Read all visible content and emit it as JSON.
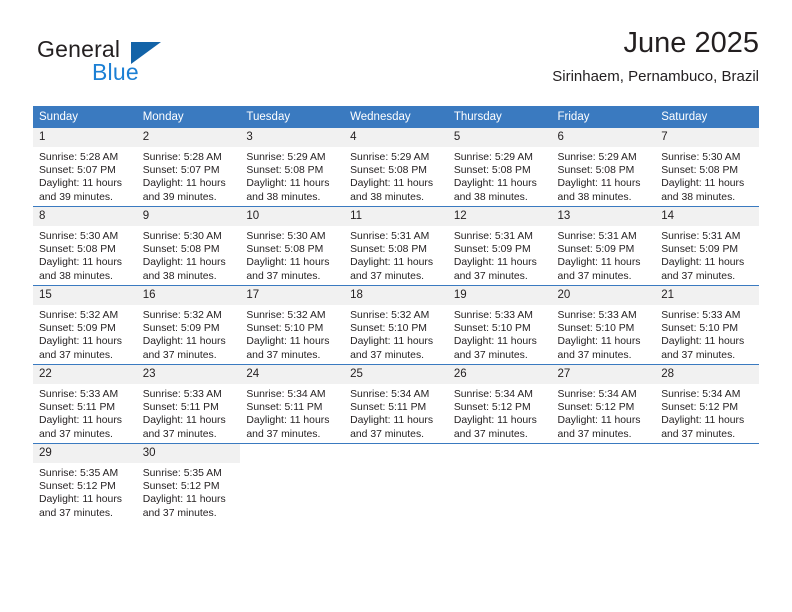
{
  "brand": {
    "name_top": "General",
    "name_bottom": "Blue",
    "color_dark": "#231f20",
    "color_blue": "#1b7fd4",
    "triangle_color": "#1263a8"
  },
  "header": {
    "title": "June 2025",
    "subtitle": "Sirinhaem, Pernambuco, Brazil"
  },
  "theme": {
    "header_bg": "#3a7ac0",
    "header_text": "#ffffff",
    "daynum_bg": "#f1f1f1",
    "cell_bg": "#ffffff",
    "rule_color": "#3a7ac0"
  },
  "calendar": {
    "weekdays": [
      "Sunday",
      "Monday",
      "Tuesday",
      "Wednesday",
      "Thursday",
      "Friday",
      "Saturday"
    ],
    "weeks": [
      [
        {
          "day": "1",
          "sunrise": "Sunrise: 5:28 AM",
          "sunset": "Sunset: 5:07 PM",
          "daylight": "Daylight: 11 hours and 39 minutes."
        },
        {
          "day": "2",
          "sunrise": "Sunrise: 5:28 AM",
          "sunset": "Sunset: 5:07 PM",
          "daylight": "Daylight: 11 hours and 39 minutes."
        },
        {
          "day": "3",
          "sunrise": "Sunrise: 5:29 AM",
          "sunset": "Sunset: 5:08 PM",
          "daylight": "Daylight: 11 hours and 38 minutes."
        },
        {
          "day": "4",
          "sunrise": "Sunrise: 5:29 AM",
          "sunset": "Sunset: 5:08 PM",
          "daylight": "Daylight: 11 hours and 38 minutes."
        },
        {
          "day": "5",
          "sunrise": "Sunrise: 5:29 AM",
          "sunset": "Sunset: 5:08 PM",
          "daylight": "Daylight: 11 hours and 38 minutes."
        },
        {
          "day": "6",
          "sunrise": "Sunrise: 5:29 AM",
          "sunset": "Sunset: 5:08 PM",
          "daylight": "Daylight: 11 hours and 38 minutes."
        },
        {
          "day": "7",
          "sunrise": "Sunrise: 5:30 AM",
          "sunset": "Sunset: 5:08 PM",
          "daylight": "Daylight: 11 hours and 38 minutes."
        }
      ],
      [
        {
          "day": "8",
          "sunrise": "Sunrise: 5:30 AM",
          "sunset": "Sunset: 5:08 PM",
          "daylight": "Daylight: 11 hours and 38 minutes."
        },
        {
          "day": "9",
          "sunrise": "Sunrise: 5:30 AM",
          "sunset": "Sunset: 5:08 PM",
          "daylight": "Daylight: 11 hours and 38 minutes."
        },
        {
          "day": "10",
          "sunrise": "Sunrise: 5:30 AM",
          "sunset": "Sunset: 5:08 PM",
          "daylight": "Daylight: 11 hours and 37 minutes."
        },
        {
          "day": "11",
          "sunrise": "Sunrise: 5:31 AM",
          "sunset": "Sunset: 5:08 PM",
          "daylight": "Daylight: 11 hours and 37 minutes."
        },
        {
          "day": "12",
          "sunrise": "Sunrise: 5:31 AM",
          "sunset": "Sunset: 5:09 PM",
          "daylight": "Daylight: 11 hours and 37 minutes."
        },
        {
          "day": "13",
          "sunrise": "Sunrise: 5:31 AM",
          "sunset": "Sunset: 5:09 PM",
          "daylight": "Daylight: 11 hours and 37 minutes."
        },
        {
          "day": "14",
          "sunrise": "Sunrise: 5:31 AM",
          "sunset": "Sunset: 5:09 PM",
          "daylight": "Daylight: 11 hours and 37 minutes."
        }
      ],
      [
        {
          "day": "15",
          "sunrise": "Sunrise: 5:32 AM",
          "sunset": "Sunset: 5:09 PM",
          "daylight": "Daylight: 11 hours and 37 minutes."
        },
        {
          "day": "16",
          "sunrise": "Sunrise: 5:32 AM",
          "sunset": "Sunset: 5:09 PM",
          "daylight": "Daylight: 11 hours and 37 minutes."
        },
        {
          "day": "17",
          "sunrise": "Sunrise: 5:32 AM",
          "sunset": "Sunset: 5:10 PM",
          "daylight": "Daylight: 11 hours and 37 minutes."
        },
        {
          "day": "18",
          "sunrise": "Sunrise: 5:32 AM",
          "sunset": "Sunset: 5:10 PM",
          "daylight": "Daylight: 11 hours and 37 minutes."
        },
        {
          "day": "19",
          "sunrise": "Sunrise: 5:33 AM",
          "sunset": "Sunset: 5:10 PM",
          "daylight": "Daylight: 11 hours and 37 minutes."
        },
        {
          "day": "20",
          "sunrise": "Sunrise: 5:33 AM",
          "sunset": "Sunset: 5:10 PM",
          "daylight": "Daylight: 11 hours and 37 minutes."
        },
        {
          "day": "21",
          "sunrise": "Sunrise: 5:33 AM",
          "sunset": "Sunset: 5:10 PM",
          "daylight": "Daylight: 11 hours and 37 minutes."
        }
      ],
      [
        {
          "day": "22",
          "sunrise": "Sunrise: 5:33 AM",
          "sunset": "Sunset: 5:11 PM",
          "daylight": "Daylight: 11 hours and 37 minutes."
        },
        {
          "day": "23",
          "sunrise": "Sunrise: 5:33 AM",
          "sunset": "Sunset: 5:11 PM",
          "daylight": "Daylight: 11 hours and 37 minutes."
        },
        {
          "day": "24",
          "sunrise": "Sunrise: 5:34 AM",
          "sunset": "Sunset: 5:11 PM",
          "daylight": "Daylight: 11 hours and 37 minutes."
        },
        {
          "day": "25",
          "sunrise": "Sunrise: 5:34 AM",
          "sunset": "Sunset: 5:11 PM",
          "daylight": "Daylight: 11 hours and 37 minutes."
        },
        {
          "day": "26",
          "sunrise": "Sunrise: 5:34 AM",
          "sunset": "Sunset: 5:12 PM",
          "daylight": "Daylight: 11 hours and 37 minutes."
        },
        {
          "day": "27",
          "sunrise": "Sunrise: 5:34 AM",
          "sunset": "Sunset: 5:12 PM",
          "daylight": "Daylight: 11 hours and 37 minutes."
        },
        {
          "day": "28",
          "sunrise": "Sunrise: 5:34 AM",
          "sunset": "Sunset: 5:12 PM",
          "daylight": "Daylight: 11 hours and 37 minutes."
        }
      ],
      [
        {
          "day": "29",
          "sunrise": "Sunrise: 5:35 AM",
          "sunset": "Sunset: 5:12 PM",
          "daylight": "Daylight: 11 hours and 37 minutes."
        },
        {
          "day": "30",
          "sunrise": "Sunrise: 5:35 AM",
          "sunset": "Sunset: 5:12 PM",
          "daylight": "Daylight: 11 hours and 37 minutes."
        },
        {
          "day": "",
          "sunrise": "",
          "sunset": "",
          "daylight": ""
        },
        {
          "day": "",
          "sunrise": "",
          "sunset": "",
          "daylight": ""
        },
        {
          "day": "",
          "sunrise": "",
          "sunset": "",
          "daylight": ""
        },
        {
          "day": "",
          "sunrise": "",
          "sunset": "",
          "daylight": ""
        },
        {
          "day": "",
          "sunrise": "",
          "sunset": "",
          "daylight": ""
        }
      ]
    ]
  }
}
